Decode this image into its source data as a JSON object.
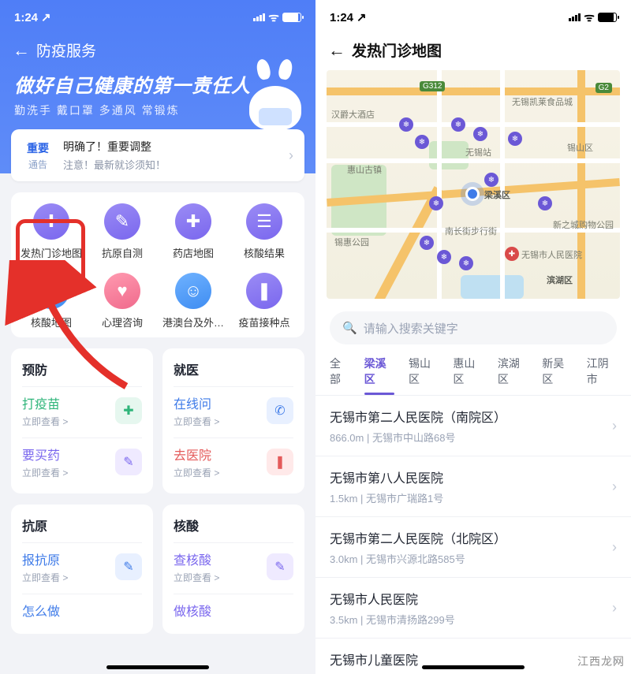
{
  "status": {
    "time": "1:24",
    "loc_icon": "↗"
  },
  "left": {
    "title": "防疫服务",
    "banner_title": "做好自己健康的第一责任人",
    "banner_sub": "勤洗手 戴口罩 多通风 常锻炼",
    "notice": {
      "badge_top": "重要",
      "badge_bottom": "通告",
      "line1": "明确了！重要调整",
      "line2": "注意！最新就诊须知！"
    },
    "grid": {
      "row1": [
        {
          "label": "发热门诊地图",
          "glyph": "✚"
        },
        {
          "label": "抗原自测",
          "glyph": "✎"
        },
        {
          "label": "药店地图",
          "glyph": "✚"
        },
        {
          "label": "核酸结果",
          "glyph": "☰"
        }
      ],
      "row2": [
        {
          "label": "核酸地图",
          "glyph": "◎"
        },
        {
          "label": "心理咨询",
          "glyph": "♥"
        },
        {
          "label": "港澳台及外…",
          "glyph": "☺"
        },
        {
          "label": "疫苗接种点",
          "glyph": "❚"
        }
      ]
    },
    "sections": {
      "prevent": {
        "title": "预防",
        "items": [
          {
            "title": "打疫苗",
            "sub": "立即查看 >",
            "cls": "green",
            "glyph": "✚"
          },
          {
            "title": "要买药",
            "sub": "立即查看 >",
            "cls": "purple",
            "glyph": "✎"
          }
        ]
      },
      "treat": {
        "title": "就医",
        "items": [
          {
            "title": "在线问",
            "sub": "立即查看 >",
            "cls": "blue",
            "glyph": "✆"
          },
          {
            "title": "去医院",
            "sub": "立即查看 >",
            "cls": "red",
            "glyph": "❚"
          }
        ]
      },
      "antigen": {
        "title": "抗原",
        "items": [
          {
            "title": "报抗原",
            "sub": "立即查看 >",
            "cls": "blue",
            "glyph": "✎"
          },
          {
            "title": "怎么做",
            "sub": "",
            "cls": "blue",
            "glyph": ""
          }
        ]
      },
      "pcr": {
        "title": "核酸",
        "items": [
          {
            "title": "查核酸",
            "sub": "立即查看 >",
            "cls": "purple",
            "glyph": "✎"
          },
          {
            "title": "做核酸",
            "sub": "",
            "cls": "purple",
            "glyph": ""
          }
        ]
      }
    }
  },
  "right": {
    "title": "发热门诊地图",
    "map_labels": {
      "g312": "G312",
      "g2": "G2",
      "food": "无锡凯莱食品城",
      "hotel": "汉爵大酒店",
      "wuxi": "无锡站",
      "huishan": "惠山古镇",
      "xishan": "锡山区",
      "liangxi": "梁溪区",
      "nanchang": "南长街步行街",
      "xincheng": "新之城购物公园",
      "peoplehosp": "无锡市人民医院",
      "binhu": "滨湖区",
      "xihui": "锡惠公园"
    },
    "search_placeholder": "请输入搜索关键字",
    "tabs": [
      "全部",
      "梁溪区",
      "锡山区",
      "惠山区",
      "滨湖区",
      "新吴区",
      "江阴市"
    ],
    "active_tab": 1,
    "results": [
      {
        "name": "无锡市第二人民医院（南院区）",
        "sub": "866.0m | 无锡市中山路68号"
      },
      {
        "name": "无锡市第八人民医院",
        "sub": "1.5km | 无锡市广瑞路1号"
      },
      {
        "name": "无锡市第二人民医院（北院区）",
        "sub": "3.0km | 无锡市兴源北路585号"
      },
      {
        "name": "无锡市人民医院",
        "sub": "3.5km | 无锡市清扬路299号"
      },
      {
        "name": "无锡市儿童医院",
        "sub": ""
      }
    ]
  },
  "watermark": "江西龙网"
}
